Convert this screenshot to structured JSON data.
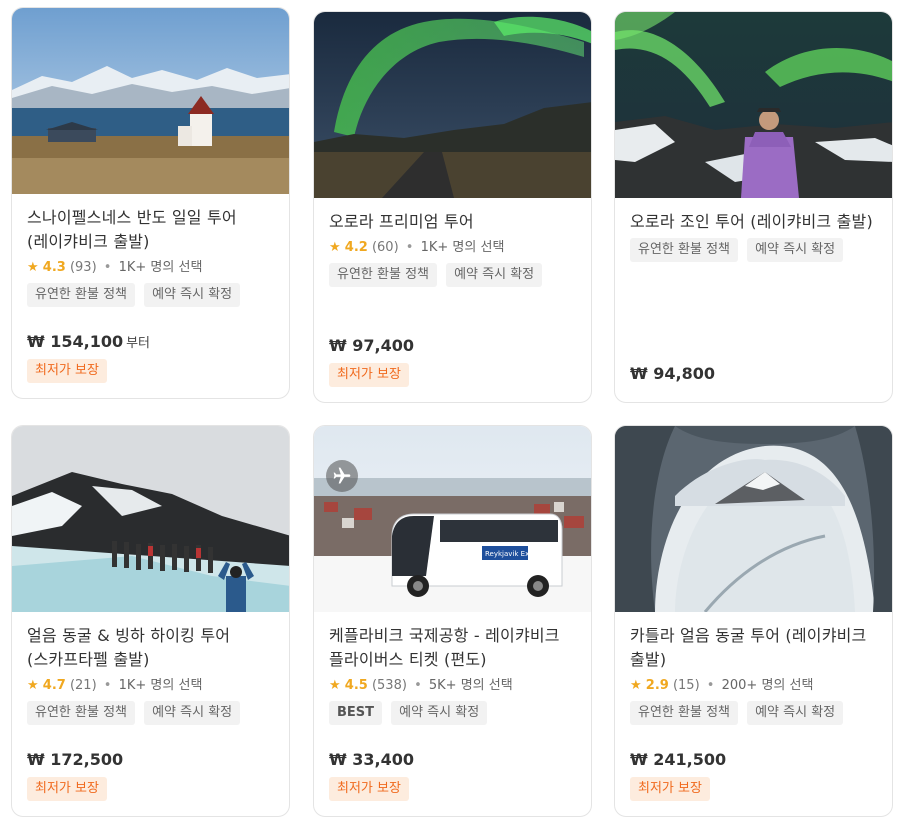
{
  "cards": [
    {
      "title": "스나이펠스네스 반도 일일 투어 (레이캬비크 출발)",
      "star": "★",
      "rating": "4.3",
      "count": "(93)",
      "booked": "1K+ 명의 선택",
      "tags": [
        "유연한 환불 정책",
        "예약 즉시 확정"
      ],
      "price": "₩ 154,100",
      "price_suffix": "부터",
      "badge": "최저가 보장"
    },
    {
      "title": "오로라 프리미엄 투어",
      "star": "★",
      "rating": "4.2",
      "count": "(60)",
      "booked": "1K+ 명의 선택",
      "tags": [
        "유연한 환불 정책",
        "예약 즉시 확정"
      ],
      "price": "₩ 97,400",
      "badge": "최저가 보장"
    },
    {
      "title": "오로라 조인 투어 (레이캬비크 출발)",
      "tags": [
        "유연한 환불 정책",
        "예약 즉시 확정"
      ],
      "price": "₩ 94,800"
    },
    {
      "title": "얼음 동굴 & 빙하 하이킹 투어 (스카프타펠 출발)",
      "star": "★",
      "rating": "4.7",
      "count": "(21)",
      "booked": "1K+ 명의 선택",
      "tags": [
        "유연한 환불 정책",
        "예약 즉시 확정"
      ],
      "price": "₩ 172,500",
      "badge": "최저가 보장"
    },
    {
      "title": "케플라비크 국제공항 - 레이캬비크 플라이버스 티켓 (편도)",
      "star": "★",
      "rating": "4.5",
      "count": "(538)",
      "booked": "5K+ 명의 선택",
      "tags": [
        "BEST",
        "예약 즉시 확정"
      ],
      "price": "₩ 33,400",
      "badge": "최저가 보장",
      "bus_logo": "Reykjavik Excursions",
      "plane_icon": "airplane-icon"
    },
    {
      "title": "카틀라 얼음 동굴 투어 (레이캬비크 출발)",
      "star": "★",
      "rating": "2.9",
      "count": "(15)",
      "booked": "200+ 명의 선택",
      "tags": [
        "유연한 환불 정책",
        "예약 즉시 확정"
      ],
      "price": "₩ 241,500",
      "badge": "최저가 보장"
    }
  ],
  "colors": {
    "star": "#f0a820",
    "badge_bg": "#fdecde",
    "badge_text": "#f06a1e",
    "tag_bg": "#f2f2f2"
  }
}
